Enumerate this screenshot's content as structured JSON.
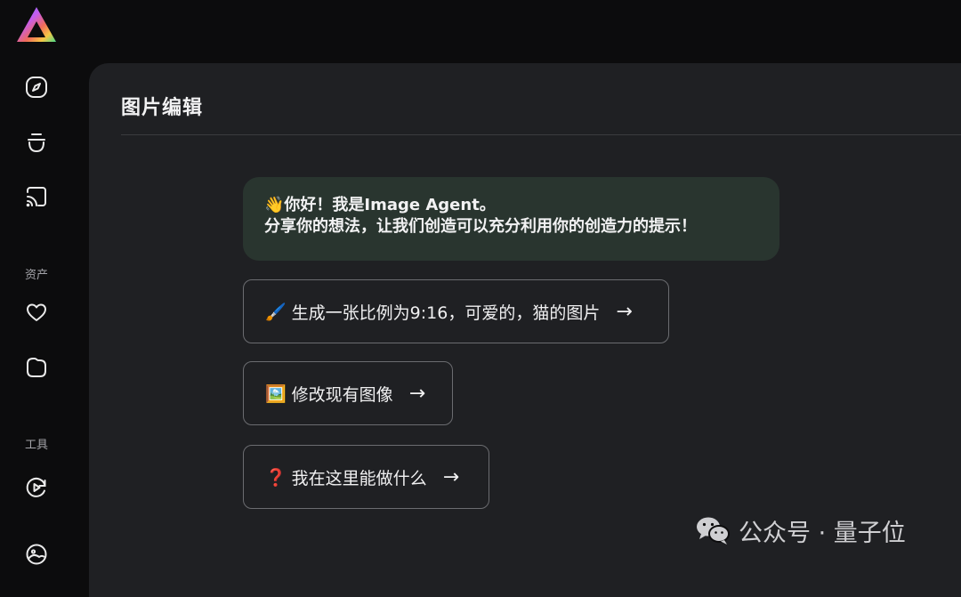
{
  "sidebar": {
    "items": [
      {
        "icon": "compass-icon"
      },
      {
        "icon": "cup-icon"
      },
      {
        "icon": "cast-icon"
      }
    ],
    "assets_label": "资产",
    "asset_items": [
      {
        "icon": "heart-icon"
      },
      {
        "icon": "folder-icon"
      }
    ],
    "tools_label": "工具",
    "tool_items": [
      {
        "icon": "play-refresh-icon"
      },
      {
        "icon": "image-tool-icon"
      }
    ]
  },
  "main": {
    "title": "图片编辑",
    "greeting": {
      "line1": "👋你好！我是Image Agent。",
      "line2": "分享你的想法，让我们创造可以充分利用你的创造力的提示！"
    },
    "prompts": [
      {
        "emoji": "🖌️",
        "label": "生成一张比例为9:16，可爱的，猫的图片",
        "arrow": "→"
      },
      {
        "emoji": "🖼️",
        "label": "修改现有图像",
        "arrow": "→"
      },
      {
        "emoji": "❓",
        "label": "我在这里能做什么",
        "arrow": "→"
      }
    ]
  },
  "watermark": {
    "text": "公众号 · 量子位"
  },
  "colors": {
    "background": "#0c0c0d",
    "panel": "#1f2023",
    "greeting_bubble": "#29352f",
    "prompt_border": "#6b6c70"
  }
}
